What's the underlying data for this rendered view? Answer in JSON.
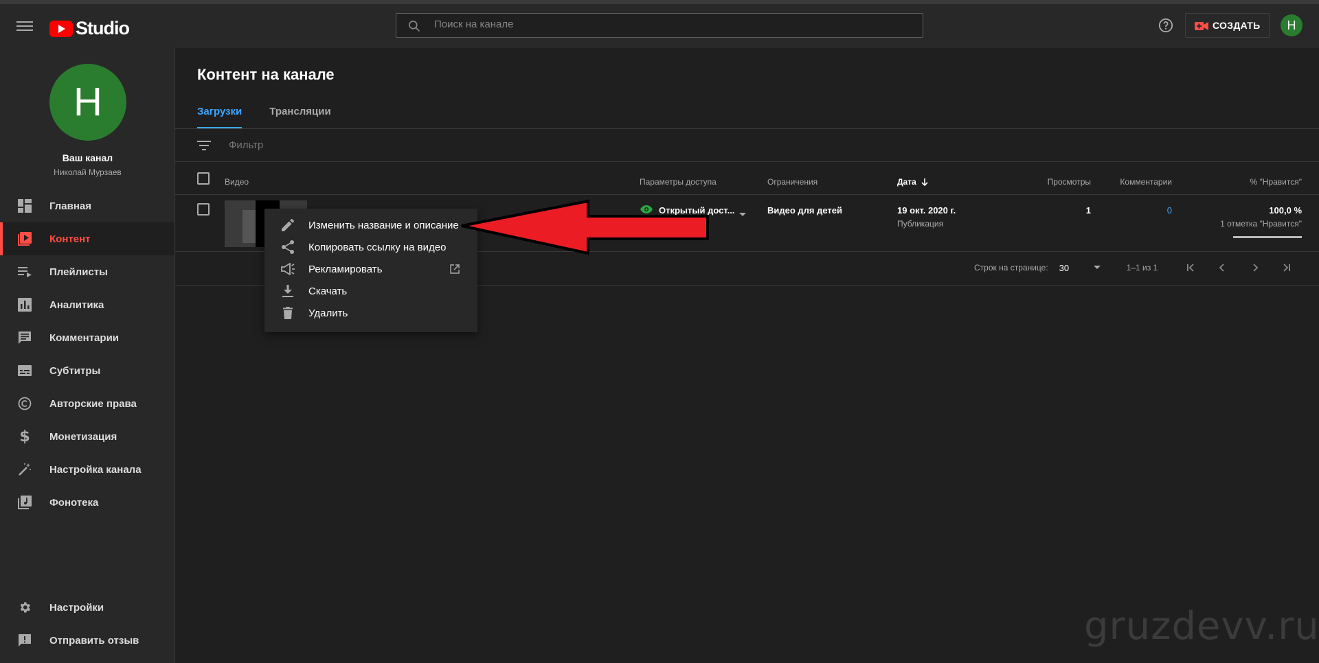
{
  "header": {
    "logo_text": "Studio",
    "search_placeholder": "Поиск на канале",
    "create_label": "СОЗДАТЬ",
    "avatar_letter": "Н"
  },
  "sidebar": {
    "channel_avatar_letter": "Н",
    "channel_title": "Ваш канал",
    "channel_owner": "Николай Мурзаев",
    "items": [
      {
        "label": "Главная",
        "icon": "dashboard-icon"
      },
      {
        "label": "Контент",
        "icon": "content-icon",
        "active": true
      },
      {
        "label": "Плейлисты",
        "icon": "playlists-icon"
      },
      {
        "label": "Аналитика",
        "icon": "analytics-icon"
      },
      {
        "label": "Комментарии",
        "icon": "comments-icon"
      },
      {
        "label": "Субтитры",
        "icon": "subtitles-icon"
      },
      {
        "label": "Авторские права",
        "icon": "copyright-icon"
      },
      {
        "label": "Монетизация",
        "icon": "dollar-icon"
      },
      {
        "label": "Настройка канала",
        "icon": "magic-wand-icon"
      },
      {
        "label": "Фонотека",
        "icon": "audio-library-icon"
      }
    ],
    "bottom_items": [
      {
        "label": "Настройки",
        "icon": "gear-icon"
      },
      {
        "label": "Отправить отзыв",
        "icon": "feedback-icon"
      }
    ]
  },
  "main": {
    "title": "Контент на канале",
    "tabs": [
      {
        "label": "Загрузки",
        "active": true
      },
      {
        "label": "Трансляции"
      }
    ],
    "filter_placeholder": "Фильтр",
    "columns": {
      "video": "Видео",
      "visibility": "Параметры доступа",
      "restrictions": "Ограничения",
      "date": "Дата",
      "views": "Просмотры",
      "comments": "Комментарии",
      "likes": "% \"Нравится\""
    },
    "row": {
      "visibility": "Открытый дост...",
      "restrictions": "Видео для детей",
      "date": "19 окт. 2020 г.",
      "date_status": "Публикация",
      "views": "1",
      "comments": "0",
      "likes_percent": "100,0 %",
      "likes_count": "1 отметка \"Нравится\"",
      "likes_ratio": 1.0
    },
    "pagination": {
      "rows_label": "Строк на странице:",
      "rows_value": "30",
      "range": "1–1 из 1"
    }
  },
  "context_menu": {
    "items": [
      {
        "label": "Изменить название и описание",
        "icon": "pencil-icon"
      },
      {
        "label": "Копировать ссылку на видео",
        "icon": "share-icon"
      },
      {
        "label": "Рекламировать",
        "icon": "megaphone-icon",
        "external": true
      },
      {
        "label": "Скачать",
        "icon": "download-icon"
      },
      {
        "label": "Удалить",
        "icon": "trash-icon"
      }
    ]
  },
  "watermark": "gruzdevv.ru",
  "colors": {
    "accent_blue": "#3ea6ff",
    "active_red": "#ff4e45",
    "brand_red": "#ff0000",
    "avatar_green": "#2a7d2e",
    "annotation_arrow": "#ec1c24"
  }
}
